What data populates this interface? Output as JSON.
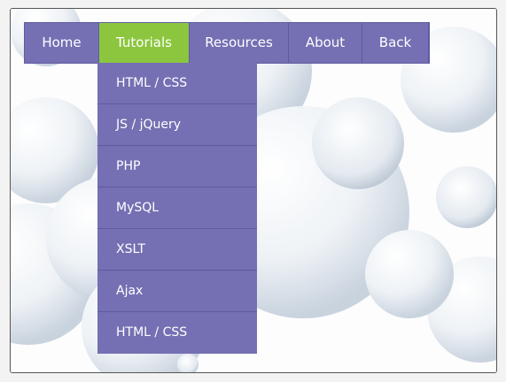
{
  "menu": {
    "items": [
      {
        "label": "Home",
        "active": false
      },
      {
        "label": "Tutorials",
        "active": true
      },
      {
        "label": "Resources",
        "active": false
      },
      {
        "label": "About",
        "active": false
      },
      {
        "label": "Back",
        "active": false
      }
    ],
    "dropdown": [
      {
        "label": "HTML / CSS"
      },
      {
        "label": "JS / jQuery"
      },
      {
        "label": "PHP"
      },
      {
        "label": "MySQL"
      },
      {
        "label": "XSLT"
      },
      {
        "label": "Ajax"
      },
      {
        "label": "HTML / CSS"
      }
    ]
  },
  "colors": {
    "menu_bg": "#7570b3",
    "active_bg": "#8cc63f",
    "text": "#ffffff"
  }
}
